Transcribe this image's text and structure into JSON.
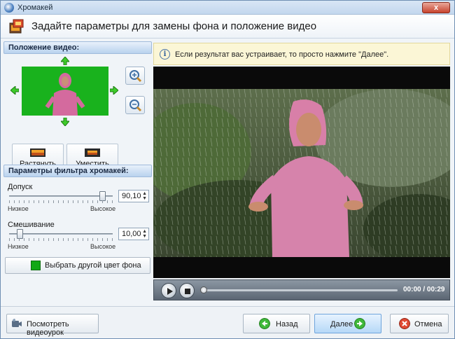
{
  "window": {
    "title": "Хромакей",
    "close_label": "x"
  },
  "header": {
    "title": "Задайте параметры для замены фона и положение видео"
  },
  "left": {
    "position_title": "Положение видео:",
    "stretch_label": "Растянуть",
    "fit_label": "Уместить",
    "filter_title": "Параметры фильтра хромакей:",
    "tolerance": {
      "label": "Допуск",
      "value": "90,10",
      "min_label": "Низкое",
      "max_label": "Высокое",
      "fraction": 0.9
    },
    "blending": {
      "label": "Смешивание",
      "value": "10,00",
      "min_label": "Низкое",
      "max_label": "Высокое",
      "fraction": 0.1
    },
    "color_button_label": "Выбрать другой цвет фона",
    "key_color": "#12a815"
  },
  "right": {
    "info_text": "Если результат вас устраивает, то просто нажмите \"Далее\".",
    "timecode": "00:00 / 00:29"
  },
  "footer": {
    "tutorial_label": "Посмотреть видеоурок",
    "back_label": "Назад",
    "next_label": "Далее",
    "cancel_label": "Отмена"
  }
}
